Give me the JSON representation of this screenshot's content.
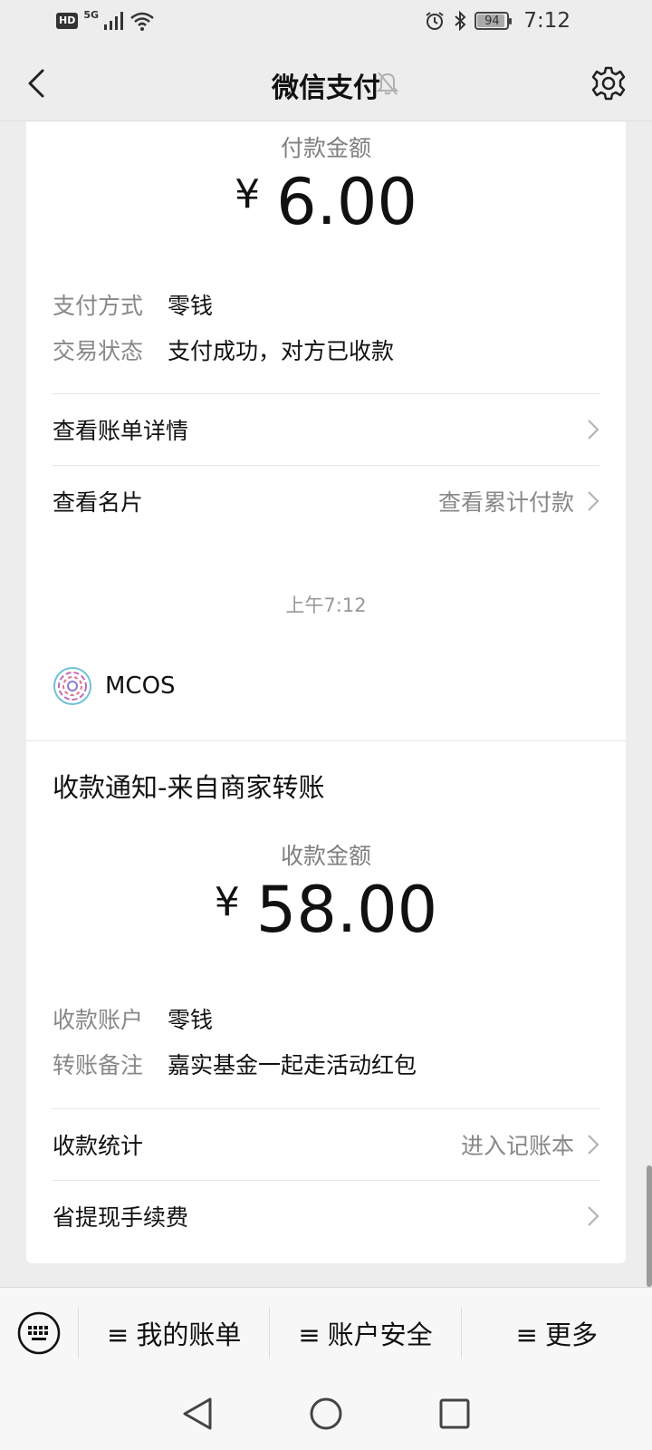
{
  "status_bar": {
    "hd": "HD",
    "network": "5G",
    "battery": "94",
    "battery_level": 0.94,
    "time": "7:12"
  },
  "header": {
    "title": "微信支付",
    "back_icon": "chevron-left-icon",
    "mute_icon": "bell-off-icon",
    "settings_icon": "gear-icon"
  },
  "payment_card": {
    "amount_label": "付款金额",
    "currency": "¥",
    "amount": "6.00",
    "details": [
      {
        "key": "支付方式",
        "value": "零钱"
      },
      {
        "key": "交易状态",
        "value": "支付成功，对方已收款"
      }
    ],
    "rows": [
      {
        "label": "查看账单详情",
        "right": ""
      },
      {
        "label": "查看名片",
        "right": "查看累计付款"
      }
    ]
  },
  "timestamp": "上午7:12",
  "receipt_card": {
    "merchant": "MCOS",
    "title": "收款通知-来自商家转账",
    "amount_label": "收款金额",
    "currency": "¥",
    "amount": "58.00",
    "details": [
      {
        "key": "收款账户",
        "value": "零钱"
      },
      {
        "key": "转账备注",
        "value": "嘉实基金一起走活动红包"
      }
    ],
    "rows": [
      {
        "label": "收款统计",
        "right": "进入记账本"
      },
      {
        "label": "省提现手续费",
        "right": ""
      }
    ]
  },
  "bottom_menu": {
    "keyboard_icon": "keyboard-icon",
    "glyph": "≡",
    "items": [
      "我的账单",
      "账户安全",
      "更多"
    ]
  },
  "nav_bar": {
    "icons": [
      "nav-back-icon",
      "nav-home-icon",
      "nav-recents-icon"
    ]
  }
}
